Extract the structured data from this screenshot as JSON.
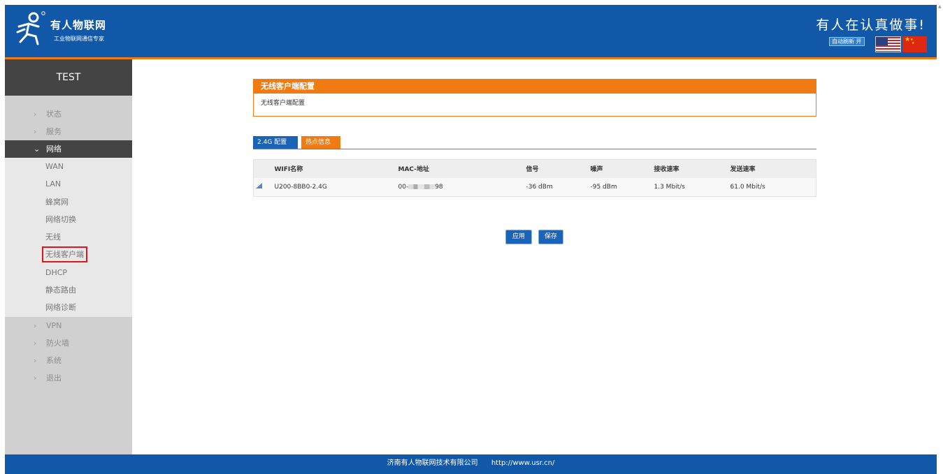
{
  "header": {
    "logo_title": "有人物联网",
    "logo_subtitle": "工业物联网通信专家",
    "slogan": "有人在认真做事!",
    "auto_refresh": "自动刷新 开",
    "colors": {
      "header_bg": "#1258a8",
      "accent": "#f07b13"
    }
  },
  "sidebar": {
    "title": "TEST",
    "items": [
      {
        "label": "状态"
      },
      {
        "label": "服务"
      },
      {
        "label": "网络",
        "expanded": true
      },
      {
        "label": "VPN"
      },
      {
        "label": "防火墙"
      },
      {
        "label": "系统"
      },
      {
        "label": "退出"
      }
    ],
    "network_sub": [
      {
        "label": "WAN"
      },
      {
        "label": "LAN"
      },
      {
        "label": "蜂窝网"
      },
      {
        "label": "网络切换"
      },
      {
        "label": "无线"
      },
      {
        "label": "无线客户端",
        "current": true
      },
      {
        "label": "DHCP"
      },
      {
        "label": "静态路由"
      },
      {
        "label": "网络诊断"
      }
    ]
  },
  "panel": {
    "title": "无线客户端配置",
    "description": "无线客户端配置"
  },
  "tabs": [
    {
      "label": "2.4G 配置"
    },
    {
      "label": "热点信息"
    }
  ],
  "table": {
    "columns": [
      "WIFI名称",
      "MAC-地址",
      "信号",
      "噪声",
      "接收速率",
      "发送速率"
    ],
    "rows": [
      {
        "signal_icon": "wifi-signal-icon",
        "name": "U200-8BB0-2.4G",
        "mac_prefix": "00-",
        "mac_suffix": "98",
        "signal": "-36 dBm",
        "noise": "-95 dBm",
        "rx": "1.3 Mbit/s",
        "tx": "61.0 Mbit/s"
      }
    ]
  },
  "buttons": {
    "apply": "应用",
    "save": "保存"
  },
  "footer": {
    "company": "济南有人物联网技术有限公司",
    "url": "http://www.usr.cn/"
  }
}
